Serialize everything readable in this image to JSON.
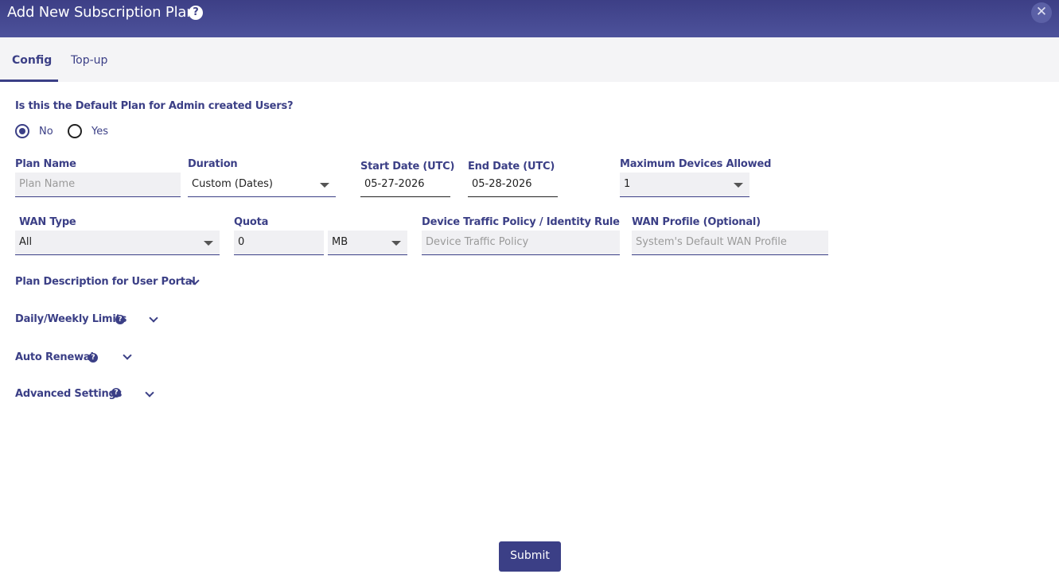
{
  "dialog": {
    "title": "Add New Subscription Plan",
    "help_icon": "question-circle-icon",
    "close_icon": "close-icon",
    "close_glyph": "✕"
  },
  "tabs": [
    {
      "label": "Config",
      "active": true
    },
    {
      "label": "Top-up",
      "active": false
    }
  ],
  "default_plan": {
    "question": "Is this the Default Plan for Admin created Users?",
    "options": [
      {
        "label": "No",
        "selected": true
      },
      {
        "label": "Yes",
        "selected": false
      }
    ]
  },
  "fields": {
    "plan_name": {
      "label": "Plan Name",
      "value": "",
      "placeholder": "Plan Name"
    },
    "duration": {
      "label": "Duration",
      "value": "Custom (Dates)"
    },
    "start_date": {
      "label": "Start Date (UTC)",
      "value": "05-27-2026"
    },
    "end_date": {
      "label": "End Date (UTC)",
      "value": "05-28-2026"
    },
    "max_devices": {
      "label": "Maximum Devices Allowed",
      "value": "1"
    },
    "wan_type": {
      "label": "WAN Type",
      "value": "All"
    },
    "quota": {
      "label": "Quota",
      "value": "0",
      "unit": "MB"
    },
    "traffic_policy": {
      "label": "Device Traffic Policy / Identity Rule",
      "value": "",
      "placeholder": "Device Traffic Policy"
    },
    "wan_profile": {
      "label": "WAN Profile (Optional)",
      "value": "",
      "placeholder": "System's Default WAN Profile"
    }
  },
  "sections": [
    {
      "label": "Plan Description for User Portal",
      "has_help": false
    },
    {
      "label": "Daily/Weekly Limits",
      "has_help": true
    },
    {
      "label": "Auto Renewal",
      "has_help": true
    },
    {
      "label": "Advanced Settings",
      "has_help": true
    }
  ],
  "submit_label": "Submit",
  "colors": {
    "primary": "#3b3f86",
    "header": "#45498f",
    "tab_bg": "#f4f4f6"
  }
}
